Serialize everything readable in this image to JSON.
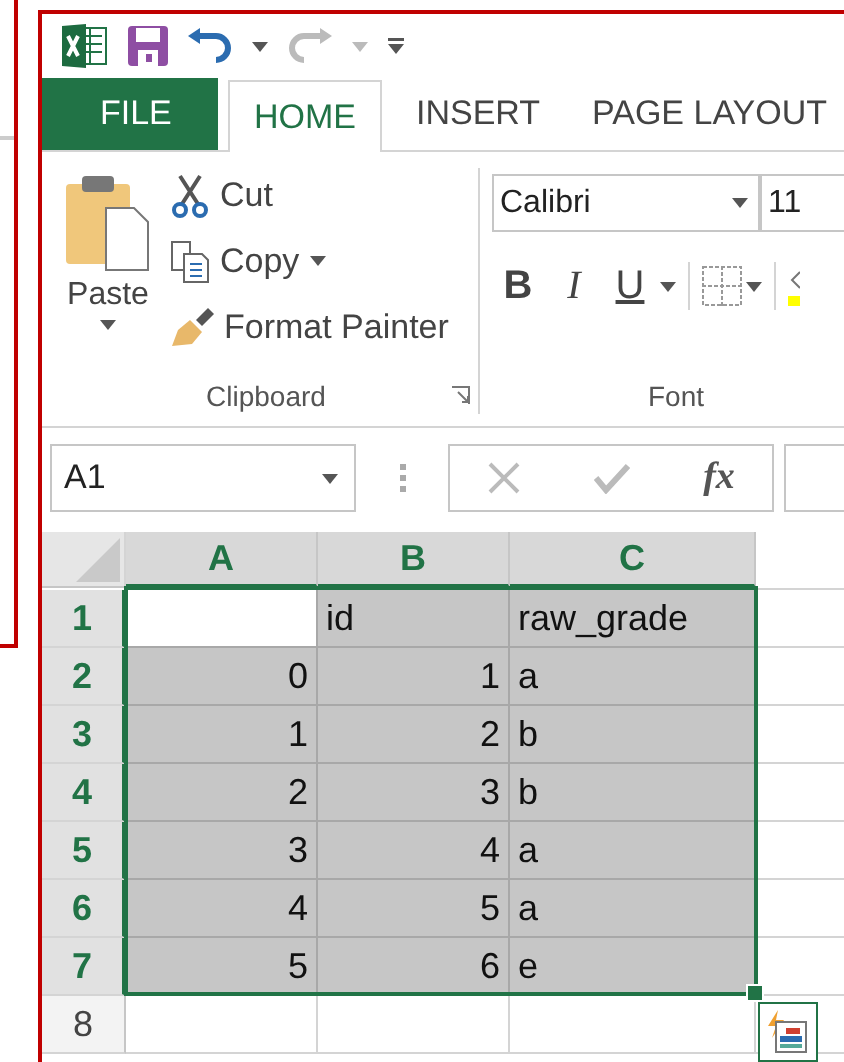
{
  "tabs": [
    {
      "label": "FILE",
      "kind": "file",
      "selected": false
    },
    {
      "label": "HOME",
      "kind": "tab",
      "selected": true
    },
    {
      "label": "INSERT",
      "kind": "tab",
      "selected": false
    },
    {
      "label": "PAGE LAYOUT",
      "kind": "tab",
      "selected": false
    }
  ],
  "clipboard": {
    "paste": "Paste",
    "cut": "Cut",
    "copy": "Copy",
    "format_painter": "Format Painter",
    "group_label": "Clipboard"
  },
  "font": {
    "name": "Calibri",
    "size": "11",
    "buttons": [
      "B",
      "I",
      "U"
    ],
    "group_label": "Font"
  },
  "formula_bar": {
    "name_box": "A1",
    "function_label": "fx"
  },
  "sheet": {
    "columns": [
      {
        "label": "A",
        "selected": true
      },
      {
        "label": "B",
        "selected": true
      },
      {
        "label": "C",
        "selected": true
      }
    ],
    "rows": [
      {
        "label": "1",
        "selected": true,
        "cells": [
          {
            "kind": "text",
            "active": true
          },
          {
            "kind": "text",
            "value": "id",
            "active": false
          },
          {
            "kind": "text",
            "value": "raw_grade",
            "active": false
          }
        ]
      },
      {
        "label": "2",
        "selected": true,
        "cells": [
          {
            "kind": "number",
            "value": "0",
            "active": false
          },
          {
            "kind": "number",
            "value": "1",
            "active": false
          },
          {
            "kind": "text",
            "value": "a",
            "active": false
          }
        ]
      },
      {
        "label": "3",
        "selected": true,
        "cells": [
          {
            "kind": "number",
            "value": "1",
            "active": false
          },
          {
            "kind": "number",
            "value": "2",
            "active": false
          },
          {
            "kind": "text",
            "value": "b",
            "active": false
          }
        ]
      },
      {
        "label": "4",
        "selected": true,
        "cells": [
          {
            "kind": "number",
            "value": "2",
            "active": false
          },
          {
            "kind": "number",
            "value": "3",
            "active": false
          },
          {
            "kind": "text",
            "value": "b",
            "active": false
          }
        ]
      },
      {
        "label": "5",
        "selected": true,
        "cells": [
          {
            "kind": "number",
            "value": "3",
            "active": false
          },
          {
            "kind": "number",
            "value": "4",
            "active": false
          },
          {
            "kind": "text",
            "value": "a",
            "active": false
          }
        ]
      },
      {
        "label": "6",
        "selected": true,
        "cells": [
          {
            "kind": "number",
            "value": "4",
            "active": false
          },
          {
            "kind": "number",
            "value": "5",
            "active": false
          },
          {
            "kind": "text",
            "value": "a",
            "active": false
          }
        ]
      },
      {
        "label": "7",
        "selected": true,
        "cells": [
          {
            "kind": "number",
            "value": "5",
            "active": false
          },
          {
            "kind": "number",
            "value": "6",
            "active": false
          },
          {
            "kind": "text",
            "value": "e",
            "active": false
          }
        ]
      },
      {
        "label": "8",
        "selected": false,
        "cells": [
          {
            "kind": "text",
            "active": false
          },
          {
            "kind": "text",
            "active": false
          },
          {
            "kind": "text",
            "active": false
          }
        ]
      }
    ]
  }
}
